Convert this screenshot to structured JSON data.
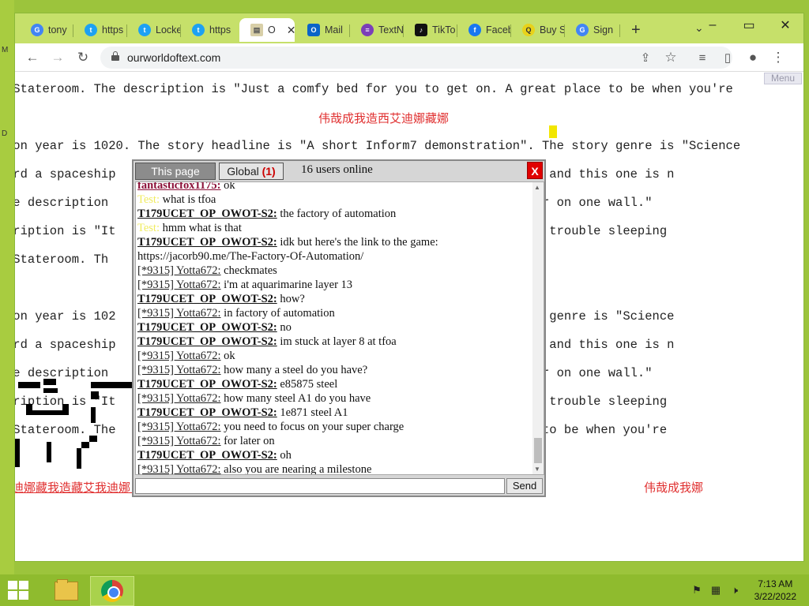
{
  "browser": {
    "tabs": [
      {
        "label": "tony",
        "icon": "google-icon"
      },
      {
        "label": "https",
        "icon": "twitter-icon"
      },
      {
        "label": "Locke",
        "icon": "twitter-icon"
      },
      {
        "label": "https",
        "icon": "twitter-icon"
      },
      {
        "label": "O",
        "icon": "page-icon",
        "active": true
      },
      {
        "label": "Mail",
        "icon": "outlook-icon"
      },
      {
        "label": "TextN",
        "icon": "textnow-icon"
      },
      {
        "label": "TikTo",
        "icon": "tiktok-icon"
      },
      {
        "label": "Faceb",
        "icon": "facebook-icon"
      },
      {
        "label": "Buy S",
        "icon": "shop-icon"
      },
      {
        "label": "Sign",
        "icon": "google-icon"
      }
    ],
    "url": "ourworldoftext.com"
  },
  "page": {
    "menu_label": "Menu",
    "lines": [
      " Stateroom. The description is \"Just a comfy bed for you to get on. A great place to be when you're",
      "ion year is 1020. The story headline is \"A short Inform7 demonstration\". The story genre is \"Science",
      "ard a spaceship                                            amped affairs, and this one is n",
      "he description                                             ere is a mirror on one wall.\"",
      "cription is \"It                                            hould you have trouble sleeping",
      " Stateroom. Th",
      "ion year is 102                                            on\". The story genre is \"Science",
      "ard a spaceship                                            amped affairs, and this one is n",
      "he description                                             ere is a mirror on one wall.\"",
      "cription is \"It                                            hould you have trouble sleeping",
      " Stateroom. The                                            A great place to be when you're"
    ],
    "red_texts": [
      "伟哉成我造西艾迪娜藏娜",
      "迪娜藏我造藏艾我迪娜_",
      "伟哉成我娜"
    ]
  },
  "chat": {
    "tab_page": "This page",
    "tab_global": "Global",
    "global_count": "(1)",
    "online": "16 users online",
    "close": "X",
    "send": "Send",
    "messages": [
      {
        "nick": "fantasticfox1175:",
        "style": "nick-red",
        "text": " ok"
      },
      {
        "nick": "Test:",
        "style": "nick-test",
        "text": " what is tfoa"
      },
      {
        "nick": "T179UCET_OP_OWOT-S2:",
        "style": "nick-bold",
        "text": " the factory of automation"
      },
      {
        "nick": "Test:",
        "style": "nick-test",
        "text": " hmm what is that"
      },
      {
        "nick": "T179UCET_OP_OWOT-S2:",
        "style": "nick-bold",
        "text": " idk but here's the link to the game: https://jacorb90.me/The-Factory-Of-Automation/"
      },
      {
        "nick": "[*9315] Yotta672:",
        "style": "nick-anon",
        "text": " checkmates"
      },
      {
        "nick": "[*9315] Yotta672:",
        "style": "nick-anon",
        "text": " i'm at aquarimarine layer 13"
      },
      {
        "nick": "T179UCET_OP_OWOT-S2:",
        "style": "nick-bold",
        "text": " how?"
      },
      {
        "nick": "[*9315] Yotta672:",
        "style": "nick-anon",
        "text": " in factory of automation"
      },
      {
        "nick": "T179UCET_OP_OWOT-S2:",
        "style": "nick-bold",
        "text": " no"
      },
      {
        "nick": "T179UCET_OP_OWOT-S2:",
        "style": "nick-bold",
        "text": " im stuck at layer 8 at tfoa"
      },
      {
        "nick": "[*9315] Yotta672:",
        "style": "nick-anon",
        "text": " ok"
      },
      {
        "nick": "[*9315] Yotta672:",
        "style": "nick-anon",
        "text": " how many a steel do you have?"
      },
      {
        "nick": "T179UCET_OP_OWOT-S2:",
        "style": "nick-bold",
        "text": " e85875 steel"
      },
      {
        "nick": "[*9315] Yotta672:",
        "style": "nick-anon",
        "text": " how many steel A1 do you have"
      },
      {
        "nick": "T179UCET_OP_OWOT-S2:",
        "style": "nick-bold",
        "text": " 1e871 steel A1"
      },
      {
        "nick": "[*9315] Yotta672:",
        "style": "nick-anon",
        "text": " you need to focus on your super charge"
      },
      {
        "nick": "[*9315] Yotta672:",
        "style": "nick-anon",
        "text": " for later on"
      },
      {
        "nick": "T179UCET_OP_OWOT-S2:",
        "style": "nick-bold",
        "text": " oh"
      },
      {
        "nick": "[*9315] Yotta672:",
        "style": "nick-anon",
        "text": " also you are nearing a milestone"
      }
    ]
  },
  "taskbar": {
    "time": "7:13 AM",
    "date": "3/22/2022"
  },
  "colors": {
    "accent": "#9cc43c",
    "close_red": "#e00000",
    "red_text": "#e03030"
  }
}
